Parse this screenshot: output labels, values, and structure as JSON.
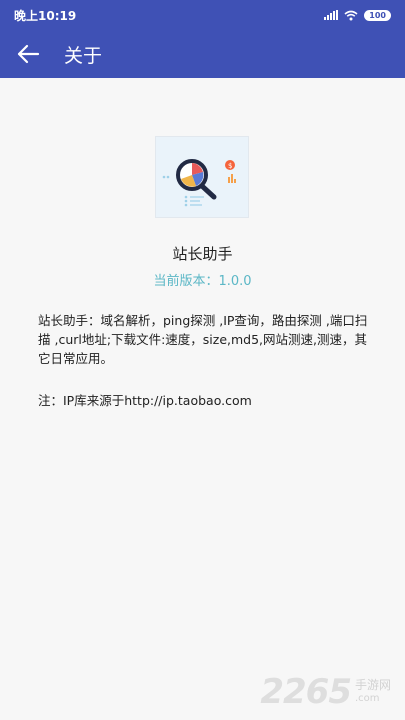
{
  "status": {
    "time": "晚上10:19",
    "battery": "100"
  },
  "appbar": {
    "title": "关于",
    "back_icon": "arrow-left-icon"
  },
  "app": {
    "name": "站长助手",
    "version": "当前版本：1.0.0"
  },
  "description": "站长助手：域名解析，ping探测 ,IP查询，路由探测 ,端口扫描 ,curl地址;下载文件:速度，size,md5,网站测速,测速，其它日常应用。",
  "note": "注：IP库来源于http://ip.taobao.com",
  "watermark": {
    "number": "2265",
    "brand": "手游网",
    "domain": ".com"
  },
  "colors": {
    "primary": "#3f51b5",
    "accent": "#5bb7c6"
  }
}
